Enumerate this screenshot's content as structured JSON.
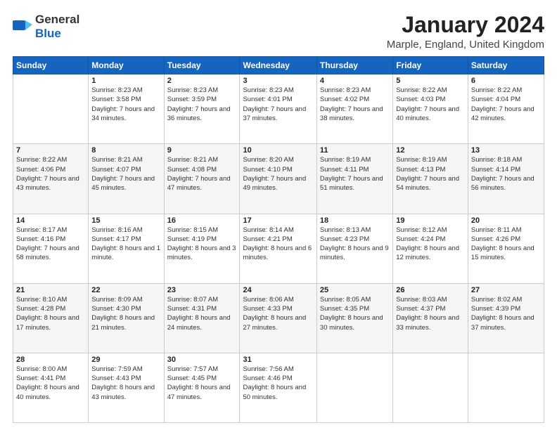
{
  "header": {
    "logo_general": "General",
    "logo_blue": "Blue",
    "title": "January 2024",
    "subtitle": "Marple, England, United Kingdom"
  },
  "days_of_week": [
    "Sunday",
    "Monday",
    "Tuesday",
    "Wednesday",
    "Thursday",
    "Friday",
    "Saturday"
  ],
  "weeks": [
    [
      {
        "day": "",
        "sunrise": "",
        "sunset": "",
        "daylight": ""
      },
      {
        "day": "1",
        "sunrise": "Sunrise: 8:23 AM",
        "sunset": "Sunset: 3:58 PM",
        "daylight": "Daylight: 7 hours and 34 minutes."
      },
      {
        "day": "2",
        "sunrise": "Sunrise: 8:23 AM",
        "sunset": "Sunset: 3:59 PM",
        "daylight": "Daylight: 7 hours and 36 minutes."
      },
      {
        "day": "3",
        "sunrise": "Sunrise: 8:23 AM",
        "sunset": "Sunset: 4:01 PM",
        "daylight": "Daylight: 7 hours and 37 minutes."
      },
      {
        "day": "4",
        "sunrise": "Sunrise: 8:23 AM",
        "sunset": "Sunset: 4:02 PM",
        "daylight": "Daylight: 7 hours and 38 minutes."
      },
      {
        "day": "5",
        "sunrise": "Sunrise: 8:22 AM",
        "sunset": "Sunset: 4:03 PM",
        "daylight": "Daylight: 7 hours and 40 minutes."
      },
      {
        "day": "6",
        "sunrise": "Sunrise: 8:22 AM",
        "sunset": "Sunset: 4:04 PM",
        "daylight": "Daylight: 7 hours and 42 minutes."
      }
    ],
    [
      {
        "day": "7",
        "sunrise": "Sunrise: 8:22 AM",
        "sunset": "Sunset: 4:06 PM",
        "daylight": "Daylight: 7 hours and 43 minutes."
      },
      {
        "day": "8",
        "sunrise": "Sunrise: 8:21 AM",
        "sunset": "Sunset: 4:07 PM",
        "daylight": "Daylight: 7 hours and 45 minutes."
      },
      {
        "day": "9",
        "sunrise": "Sunrise: 8:21 AM",
        "sunset": "Sunset: 4:08 PM",
        "daylight": "Daylight: 7 hours and 47 minutes."
      },
      {
        "day": "10",
        "sunrise": "Sunrise: 8:20 AM",
        "sunset": "Sunset: 4:10 PM",
        "daylight": "Daylight: 7 hours and 49 minutes."
      },
      {
        "day": "11",
        "sunrise": "Sunrise: 8:19 AM",
        "sunset": "Sunset: 4:11 PM",
        "daylight": "Daylight: 7 hours and 51 minutes."
      },
      {
        "day": "12",
        "sunrise": "Sunrise: 8:19 AM",
        "sunset": "Sunset: 4:13 PM",
        "daylight": "Daylight: 7 hours and 54 minutes."
      },
      {
        "day": "13",
        "sunrise": "Sunrise: 8:18 AM",
        "sunset": "Sunset: 4:14 PM",
        "daylight": "Daylight: 7 hours and 56 minutes."
      }
    ],
    [
      {
        "day": "14",
        "sunrise": "Sunrise: 8:17 AM",
        "sunset": "Sunset: 4:16 PM",
        "daylight": "Daylight: 7 hours and 58 minutes."
      },
      {
        "day": "15",
        "sunrise": "Sunrise: 8:16 AM",
        "sunset": "Sunset: 4:17 PM",
        "daylight": "Daylight: 8 hours and 1 minute."
      },
      {
        "day": "16",
        "sunrise": "Sunrise: 8:15 AM",
        "sunset": "Sunset: 4:19 PM",
        "daylight": "Daylight: 8 hours and 3 minutes."
      },
      {
        "day": "17",
        "sunrise": "Sunrise: 8:14 AM",
        "sunset": "Sunset: 4:21 PM",
        "daylight": "Daylight: 8 hours and 6 minutes."
      },
      {
        "day": "18",
        "sunrise": "Sunrise: 8:13 AM",
        "sunset": "Sunset: 4:23 PM",
        "daylight": "Daylight: 8 hours and 9 minutes."
      },
      {
        "day": "19",
        "sunrise": "Sunrise: 8:12 AM",
        "sunset": "Sunset: 4:24 PM",
        "daylight": "Daylight: 8 hours and 12 minutes."
      },
      {
        "day": "20",
        "sunrise": "Sunrise: 8:11 AM",
        "sunset": "Sunset: 4:26 PM",
        "daylight": "Daylight: 8 hours and 15 minutes."
      }
    ],
    [
      {
        "day": "21",
        "sunrise": "Sunrise: 8:10 AM",
        "sunset": "Sunset: 4:28 PM",
        "daylight": "Daylight: 8 hours and 17 minutes."
      },
      {
        "day": "22",
        "sunrise": "Sunrise: 8:09 AM",
        "sunset": "Sunset: 4:30 PM",
        "daylight": "Daylight: 8 hours and 21 minutes."
      },
      {
        "day": "23",
        "sunrise": "Sunrise: 8:07 AM",
        "sunset": "Sunset: 4:31 PM",
        "daylight": "Daylight: 8 hours and 24 minutes."
      },
      {
        "day": "24",
        "sunrise": "Sunrise: 8:06 AM",
        "sunset": "Sunset: 4:33 PM",
        "daylight": "Daylight: 8 hours and 27 minutes."
      },
      {
        "day": "25",
        "sunrise": "Sunrise: 8:05 AM",
        "sunset": "Sunset: 4:35 PM",
        "daylight": "Daylight: 8 hours and 30 minutes."
      },
      {
        "day": "26",
        "sunrise": "Sunrise: 8:03 AM",
        "sunset": "Sunset: 4:37 PM",
        "daylight": "Daylight: 8 hours and 33 minutes."
      },
      {
        "day": "27",
        "sunrise": "Sunrise: 8:02 AM",
        "sunset": "Sunset: 4:39 PM",
        "daylight": "Daylight: 8 hours and 37 minutes."
      }
    ],
    [
      {
        "day": "28",
        "sunrise": "Sunrise: 8:00 AM",
        "sunset": "Sunset: 4:41 PM",
        "daylight": "Daylight: 8 hours and 40 minutes."
      },
      {
        "day": "29",
        "sunrise": "Sunrise: 7:59 AM",
        "sunset": "Sunset: 4:43 PM",
        "daylight": "Daylight: 8 hours and 43 minutes."
      },
      {
        "day": "30",
        "sunrise": "Sunrise: 7:57 AM",
        "sunset": "Sunset: 4:45 PM",
        "daylight": "Daylight: 8 hours and 47 minutes."
      },
      {
        "day": "31",
        "sunrise": "Sunrise: 7:56 AM",
        "sunset": "Sunset: 4:46 PM",
        "daylight": "Daylight: 8 hours and 50 minutes."
      },
      {
        "day": "",
        "sunrise": "",
        "sunset": "",
        "daylight": ""
      },
      {
        "day": "",
        "sunrise": "",
        "sunset": "",
        "daylight": ""
      },
      {
        "day": "",
        "sunrise": "",
        "sunset": "",
        "daylight": ""
      }
    ]
  ]
}
